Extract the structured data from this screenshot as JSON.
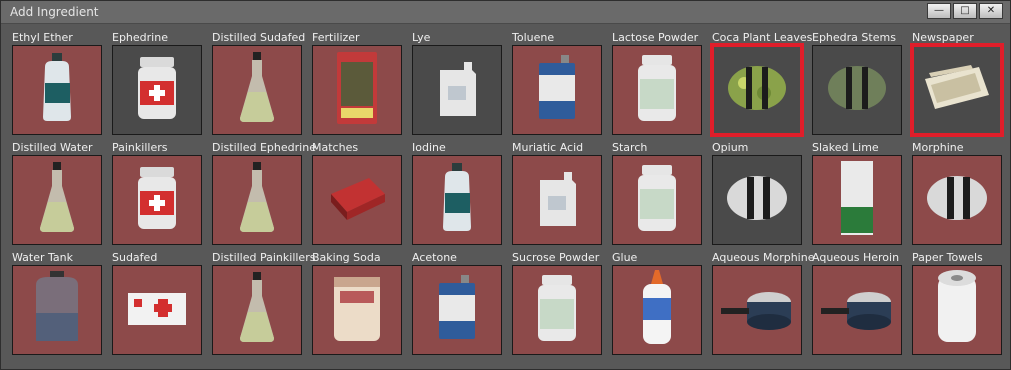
{
  "window": {
    "title": "Add Ingredient"
  },
  "controls": {
    "minimize": "—",
    "maximize": "□",
    "close": "✕"
  },
  "rows": [
    [
      {
        "name": "Ethyl Ether",
        "icon": "bottle-icon",
        "bg": "red"
      },
      {
        "name": "Ephedrine",
        "icon": "pill-jar-icon",
        "bg": "dark"
      },
      {
        "name": "Distilled Sudafed",
        "icon": "flask-icon",
        "bg": "red"
      },
      {
        "name": "Fertilizer",
        "icon": "fertilizer-bag-icon",
        "bg": "red"
      },
      {
        "name": "Lye",
        "icon": "jug-icon",
        "bg": "dark"
      },
      {
        "name": "Toluene",
        "icon": "can-icon",
        "bg": "red"
      },
      {
        "name": "Lactose Powder",
        "icon": "powder-jar-icon",
        "bg": "red"
      },
      {
        "name": "Coca Plant Leaves",
        "icon": "leaf-bundle-icon",
        "bg": "dark",
        "highlight": true
      },
      {
        "name": "Ephedra Stems",
        "icon": "stem-bundle-icon",
        "bg": "dark"
      },
      {
        "name": "Newspaper",
        "icon": "newspaper-icon",
        "bg": "dark",
        "highlight": true
      }
    ],
    [
      {
        "name": "Distilled Water",
        "icon": "flask-icon",
        "bg": "red"
      },
      {
        "name": "Painkillers",
        "icon": "pill-jar-icon",
        "bg": "red"
      },
      {
        "name": "Distilled Ephedrine",
        "icon": "flask-icon",
        "bg": "red"
      },
      {
        "name": "Matches",
        "icon": "matchbox-icon",
        "bg": "red"
      },
      {
        "name": "Iodine",
        "icon": "bottle-icon",
        "bg": "red"
      },
      {
        "name": "Muriatic Acid",
        "icon": "jug-icon",
        "bg": "red"
      },
      {
        "name": "Starch",
        "icon": "powder-jar-icon",
        "bg": "red"
      },
      {
        "name": "Opium",
        "icon": "brick-icon",
        "bg": "dark"
      },
      {
        "name": "Slaked Lime",
        "icon": "lime-box-icon",
        "bg": "red"
      },
      {
        "name": "Morphine",
        "icon": "brick-icon",
        "bg": "red"
      }
    ],
    [
      {
        "name": "Water Tank",
        "icon": "tank-icon",
        "bg": "red"
      },
      {
        "name": "Sudafed",
        "icon": "pill-box-icon",
        "bg": "red"
      },
      {
        "name": "Distilled Painkillers",
        "icon": "flask-icon",
        "bg": "red"
      },
      {
        "name": "Baking Soda",
        "icon": "baking-soda-icon",
        "bg": "red"
      },
      {
        "name": "Acetone",
        "icon": "can-icon",
        "bg": "red"
      },
      {
        "name": "Sucrose Powder",
        "icon": "powder-jar-icon",
        "bg": "red"
      },
      {
        "name": "Glue",
        "icon": "glue-bottle-icon",
        "bg": "red"
      },
      {
        "name": "Aqueous Morphine",
        "icon": "pan-icon",
        "bg": "red"
      },
      {
        "name": "Aqueous Heroin",
        "icon": "pan-icon",
        "bg": "red"
      },
      {
        "name": "Paper Towels",
        "icon": "paper-towel-icon",
        "bg": "red"
      }
    ]
  ],
  "colors": {
    "tile_red": "#8d4a4a",
    "tile_dark": "#4a4a4a",
    "highlight": "#e01e2a"
  }
}
